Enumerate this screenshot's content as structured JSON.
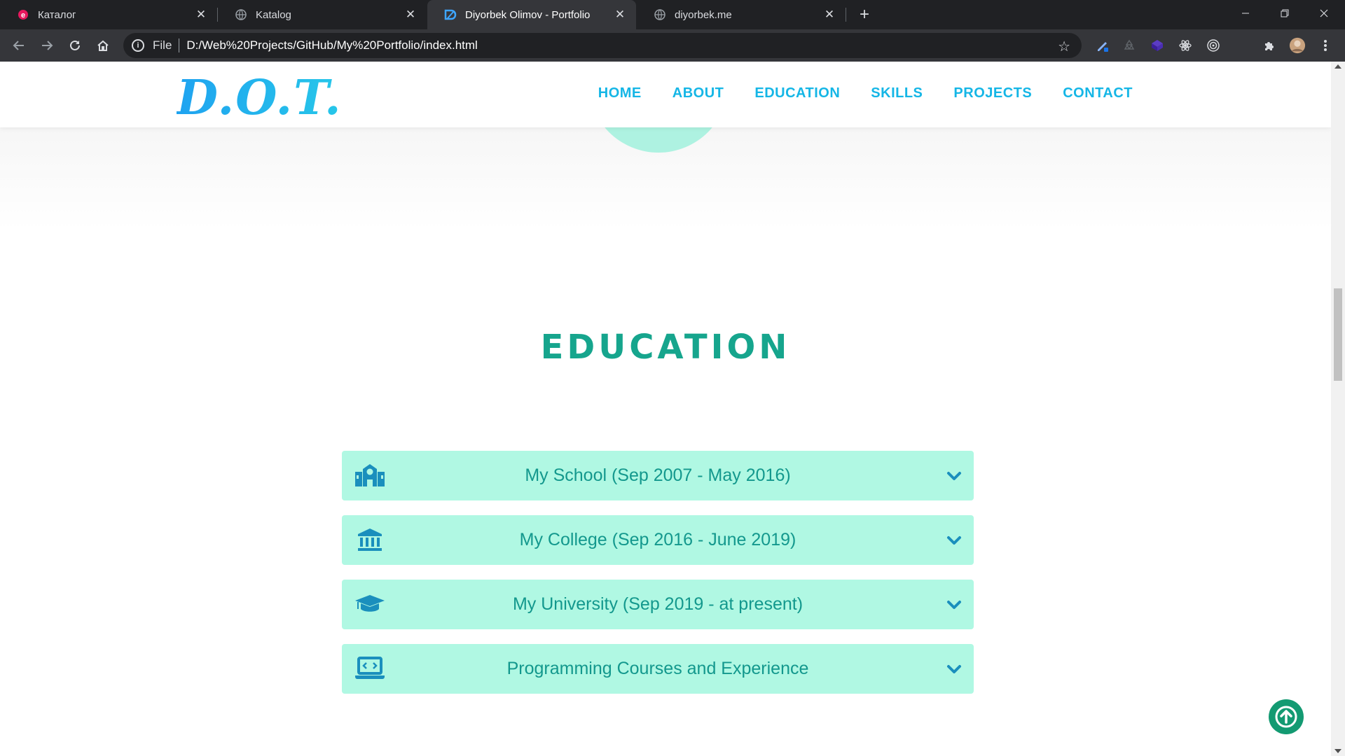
{
  "browser": {
    "tabs": [
      {
        "title": "Каталог",
        "active": false,
        "favicon": "e-red-icon"
      },
      {
        "title": "Katalog",
        "active": false,
        "favicon": "globe-icon"
      },
      {
        "title": "Diyorbek Olimov - Portfolio",
        "active": true,
        "favicon": "brand-icon"
      },
      {
        "title": "diyorbek.me",
        "active": false,
        "favicon": "globe-icon"
      }
    ],
    "address": {
      "scheme": "File",
      "url": "D:/Web%20Projects/GitHub/My%20Portfolio/index.html"
    }
  },
  "site": {
    "logo": "D.O.T.",
    "nav": [
      "HOME",
      "ABOUT",
      "EDUCATION",
      "SKILLS",
      "PROJECTS",
      "CONTACT"
    ],
    "education": {
      "title": "EDUCATION",
      "items": [
        {
          "label": "My School (Sep 2007 - May 2016)",
          "icon": "school-icon"
        },
        {
          "label": "My College (Sep 2016 - June 2019)",
          "icon": "institution-icon"
        },
        {
          "label": "My University (Sep 2019 - at present)",
          "icon": "graduation-cap-icon"
        },
        {
          "label": "Programming Courses and Experience",
          "icon": "laptop-code-icon"
        }
      ]
    }
  },
  "colors": {
    "brand": "#15b6e6",
    "heading": "#16a58d",
    "accordion_bg": "#b0f8e3",
    "accordion_text": "#13988d",
    "accent_circle": "#aef2e1",
    "to_top": "#139a72"
  }
}
